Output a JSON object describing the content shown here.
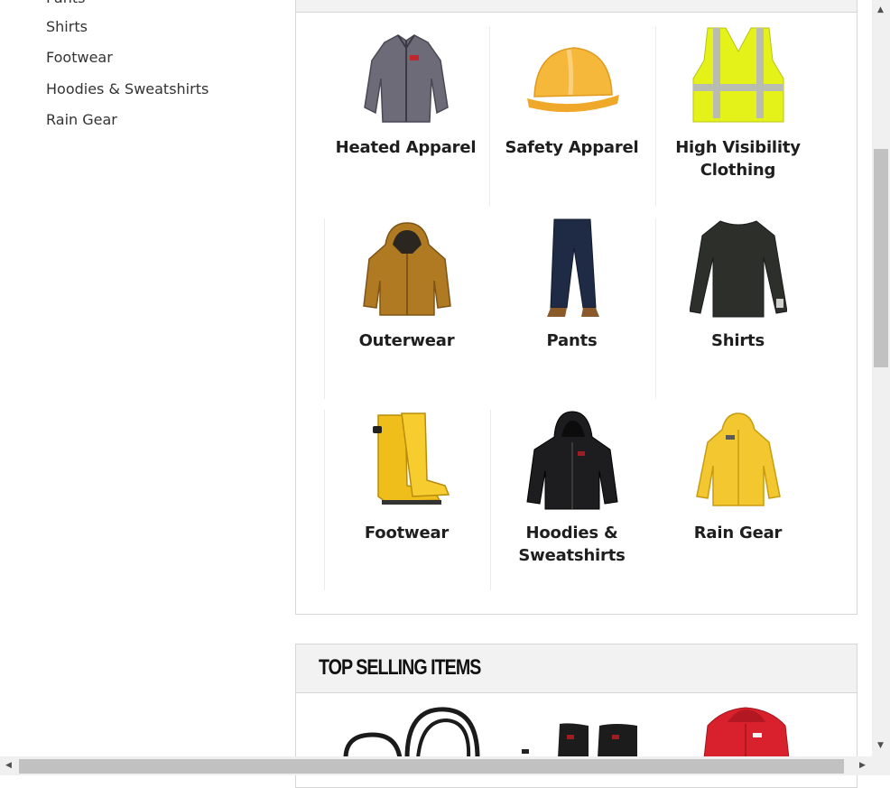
{
  "sidebar": {
    "items": [
      {
        "label": "Pants"
      },
      {
        "label": "Shirts"
      },
      {
        "label": "Footwear"
      },
      {
        "label": "Hoodies & Sweatshirts"
      },
      {
        "label": "Rain Gear"
      }
    ]
  },
  "categories": [
    {
      "label": "Heated Apparel",
      "icon": "heated-jacket-image"
    },
    {
      "label": "Safety Apparel",
      "icon": "hard-hat-image"
    },
    {
      "label": "High Visibility\nClothing",
      "icon": "hi-vis-vest-image"
    },
    {
      "label": "Outerwear",
      "icon": "outerwear-jacket-image"
    },
    {
      "label": "Pants",
      "icon": "work-pants-image"
    },
    {
      "label": "Shirts",
      "icon": "long-sleeve-shirt-image"
    },
    {
      "label": "Footwear",
      "icon": "rubber-boots-image"
    },
    {
      "label": "Hoodies &\nSweatshirts",
      "icon": "hoodie-image"
    },
    {
      "label": "Rain Gear",
      "icon": "rain-jacket-image"
    }
  ],
  "top_selling": {
    "title": "TOP SELLING ITEMS",
    "products": [
      {
        "icon": "cable-coil-image"
      },
      {
        "icon": "knee-pads-image"
      },
      {
        "icon": "red-heated-jacket-image"
      }
    ]
  },
  "colors": {
    "panel_border": "#d6d6d6",
    "header_bg": "#f2f2f2",
    "scrollbar_track": "#f0f0f0",
    "scrollbar_thumb": "#c1c1c1"
  }
}
